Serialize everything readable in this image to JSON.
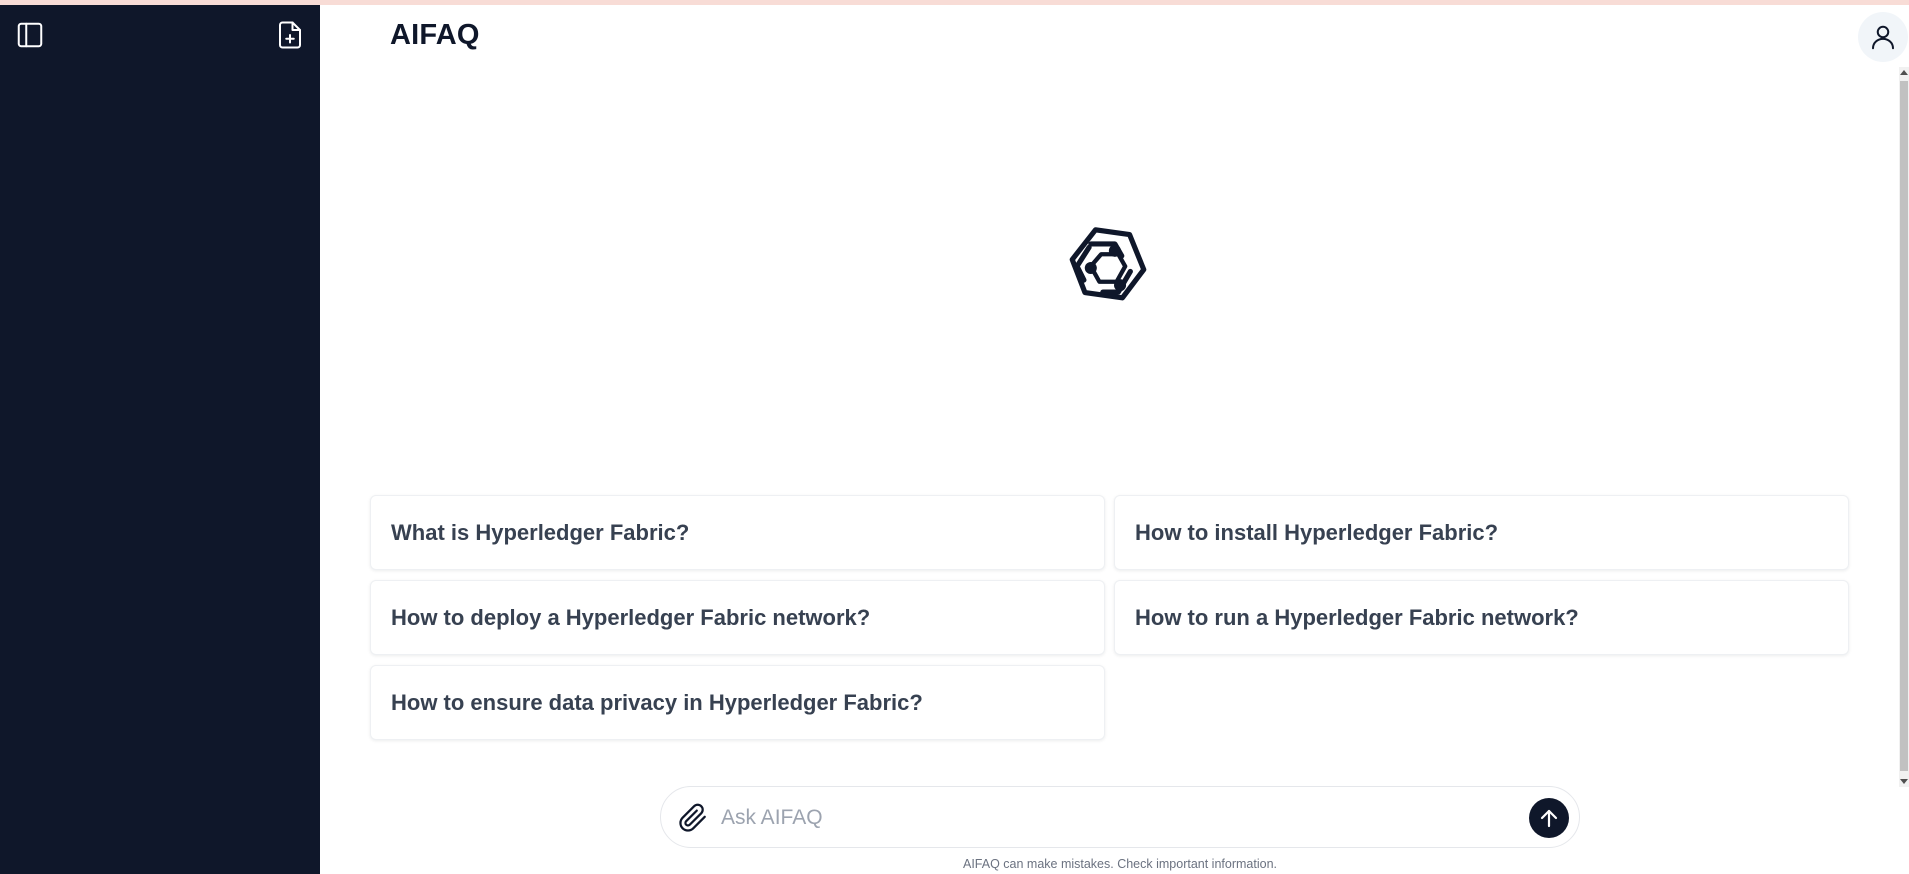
{
  "app": {
    "title": "AIFAQ"
  },
  "sidebar": {
    "toggle_icon": "sidebar-panel-icon",
    "new_chat_icon": "new-document-icon",
    "background_color": "#0f172a"
  },
  "header": {
    "user_icon": "user-icon"
  },
  "hero": {
    "logo_icon": "hyperledger-hexagon-logo-icon"
  },
  "suggestions": [
    {
      "label": "What is Hyperledger Fabric?"
    },
    {
      "label": "How to install Hyperledger Fabric?"
    },
    {
      "label": "How to deploy a Hyperledger Fabric network?"
    },
    {
      "label": "How to run a Hyperledger Fabric network?"
    },
    {
      "label": "How to ensure data privacy in Hyperledger Fabric?"
    }
  ],
  "composer": {
    "placeholder": "Ask AIFAQ",
    "value": "",
    "attach_icon": "paperclip-icon",
    "send_icon": "arrow-up-icon"
  },
  "footer": {
    "disclaimer": "AIFAQ can make mistakes. Check important information."
  },
  "colors": {
    "accent": "#0f172a",
    "suggestion_text": "#374151",
    "top_strip": "#f8dcd6"
  }
}
